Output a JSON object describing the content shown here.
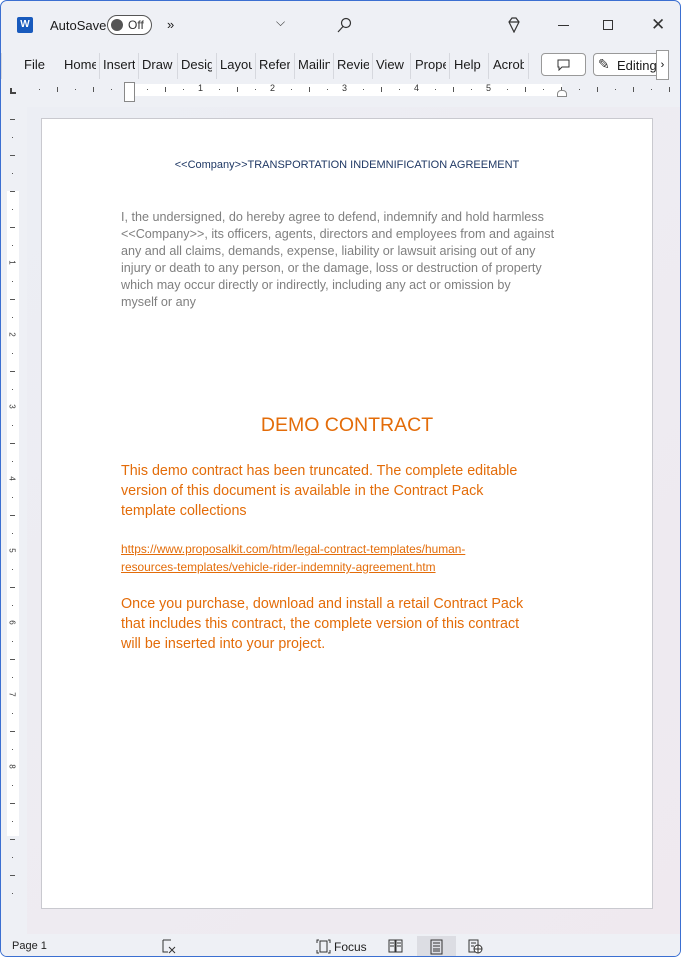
{
  "titlebar": {
    "app_icon": "word-icon",
    "autosave_label": "AutoSave",
    "autosave_state": "Off",
    "more_label": "»",
    "search_icon": "search-icon",
    "premium_icon": "diamond-icon"
  },
  "ribbon": {
    "tabs": [
      "File",
      "Home",
      "Insert",
      "Draw",
      "Design",
      "Layout",
      "References",
      "Mailings",
      "Review",
      "View",
      "Properties",
      "Help",
      "Acrobat"
    ],
    "comment_icon": "comment-icon",
    "editing_label": "Editing",
    "chevron": "›"
  },
  "ruler": {
    "ticks": [
      "1",
      "2",
      "3",
      "4",
      "5"
    ],
    "vticks": [
      "1",
      "2",
      "3",
      "4",
      "5",
      "6",
      "7",
      "8"
    ]
  },
  "document": {
    "title": "<<Company>>TRANSPORTATION INDEMNIFICATION AGREEMENT",
    "body_lines": [
      "I, the undersigned, do hereby agree to defend, indemnify and hold harmless",
      "<<Company>>, its officers, agents, directors and employees from and against",
      "any and all claims, demands, expense, liability or lawsuit arising out of any",
      "injury or death to any person, or the damage, loss or destruction of property",
      "which may occur directly or indirectly, including any act or omission by",
      "myself or any"
    ],
    "demo_heading": "DEMO CONTRACT",
    "demo_lines": [
      "This demo contract has been truncated. The complete editable",
      "version of this document is available in the Contract Pack",
      "template collections"
    ],
    "link_lines": [
      "https://www.proposalkit.com/htm/legal-contract-templates/human-",
      "resources-templates/vehicle-rider-indemnity-agreement.htm"
    ],
    "purchase_lines": [
      "Once you purchase, download and install a retail Contract Pack",
      "that includes this contract, the complete version of this contract",
      "will be inserted into your project."
    ],
    "colors": {
      "title": "#1f3864",
      "body": "#7f7f7f",
      "accent": "#e36c09"
    }
  },
  "statusbar": {
    "page": "Page 1",
    "focus": "Focus"
  }
}
